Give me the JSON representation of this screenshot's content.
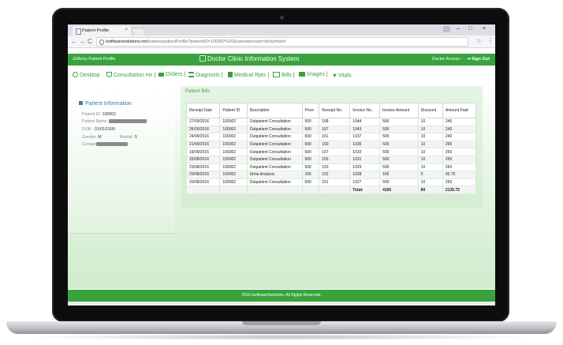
{
  "browser": {
    "tab_title": "Patient Profile",
    "tab_close": "×",
    "url_domain": "isoftwaresolutions.net",
    "url_path": "/patient/patientProfile?patientID=100002%20&zdessbessidz=bkdykhdx#",
    "window_controls": [
      "–",
      "□",
      "×"
    ],
    "back": "←",
    "forward": "→",
    "reload": "C",
    "star": "☆",
    "menu": "⋮"
  },
  "appbar": {
    "menu_label": "☰Menu",
    "page_label": "Patient Profile",
    "title": "Doctor Clinic Information System",
    "access": "Doctor Access -",
    "signout": "Sign Out",
    "signout_icon": "⇥"
  },
  "toolbar": [
    {
      "label": "Desktop",
      "icon": "circle-arrow-icon",
      "sep": ""
    },
    {
      "label": "Consultation Hx",
      "icon": "stethoscope-icon",
      "sep": "|"
    },
    {
      "label": "Orders",
      "icon": "cart-icon",
      "sep": "|"
    },
    {
      "label": "Diagnosis",
      "icon": "list-icon",
      "sep": "|"
    },
    {
      "label": "Medical Rpts",
      "icon": "report-icon",
      "sep": "|"
    },
    {
      "label": "Bills",
      "icon": "bill-icon",
      "sep": "|"
    },
    {
      "label": "Images",
      "icon": "image-icon",
      "sep": "|"
    },
    {
      "label": "Vitals",
      "icon": "heart-icon",
      "sep": ""
    }
  ],
  "patient_info": {
    "title": "Patient Information",
    "id_label": "Patient ID:",
    "id_value": "100002",
    "name_label": "Patient Name:",
    "dob_label": "DOB -",
    "dob_value": "01/01/1999",
    "gender_label": "Gender:",
    "gender_value": "M",
    "marital_label": "Marital:",
    "marital_value": "S",
    "contact_label": "Contact"
  },
  "bills": {
    "title": "Patient Bills",
    "columns": [
      "Receipt Date",
      "Patient ID",
      "Description",
      "Price",
      "Receipt No.",
      "Invoice No.",
      "Invoice Amount",
      "Discount",
      "Amount Paid"
    ],
    "rows": [
      [
        "27/09/2016",
        "100002",
        "Outpatient Consultation",
        "500",
        "168",
        "1044",
        "500",
        "10",
        "240"
      ],
      [
        "26/09/2016",
        "100002",
        "Outpatient Consultation",
        "500",
        "167",
        "1043",
        "500",
        "10",
        "240"
      ],
      [
        "24/09/2016",
        "100002",
        "Outpatient Consultation",
        "500",
        "161",
        "1037",
        "500",
        "10",
        "240"
      ],
      [
        "21/09/2016",
        "100002",
        "Outpatient Consultation",
        "500",
        "160",
        "1036",
        "500",
        "10",
        "265"
      ],
      [
        "19/09/2016",
        "100002",
        "Outpatient Consultation",
        "500",
        "157",
        "1033",
        "500",
        "10",
        "265"
      ],
      [
        "25/08/2016",
        "100002",
        "Outpatient Consultation",
        "500",
        "155",
        "1031",
        "500",
        "10",
        "265"
      ],
      [
        "23/08/2016",
        "100002",
        "Outpatient Consultation",
        "500",
        "153",
        "1029",
        "500",
        "10",
        "265"
      ],
      [
        "20/08/2016",
        "100002",
        "Urine Analysis",
        "165",
        "152",
        "1028",
        "165",
        "0",
        "90.75"
      ],
      [
        "20/08/2016",
        "100002",
        "Outpatient Consultation",
        "500",
        "151",
        "1027",
        "500",
        "10",
        "265"
      ]
    ],
    "total_label": "Total:",
    "total_invoice": "4165",
    "total_discount": "80",
    "total_paid": "2135.75"
  },
  "footer": {
    "text": "2016 IsoftwareSolutions. All Rights Reserved."
  }
}
